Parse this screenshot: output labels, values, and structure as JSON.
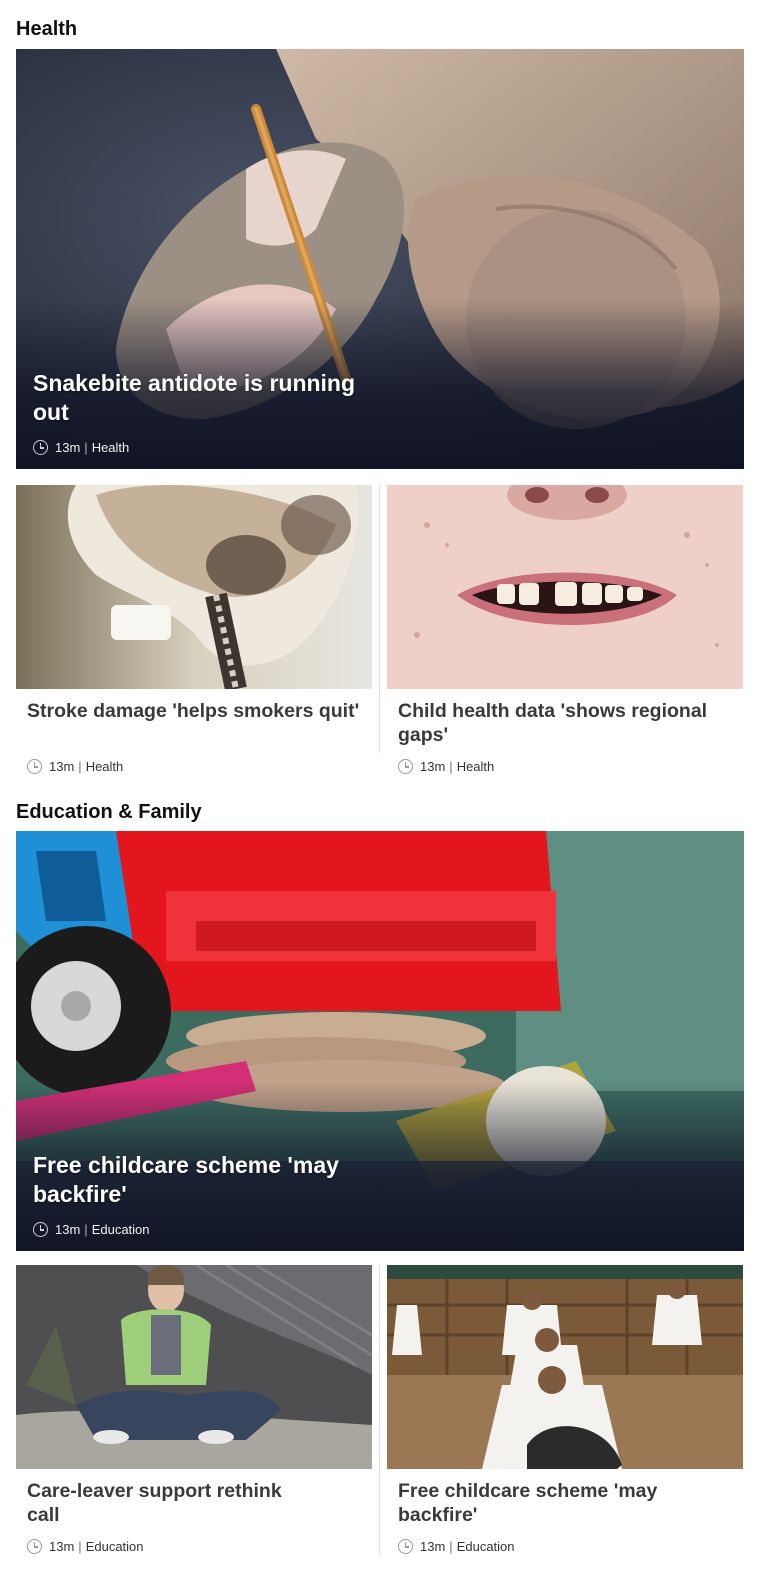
{
  "health": {
    "title": "Health",
    "hero": {
      "headline": "Snakebite antidote is running out",
      "time": "13m",
      "category": "Health"
    },
    "cards": [
      {
        "headline": "Stroke damage 'helps smokers quit'",
        "time": "13m",
        "category": "Health"
      },
      {
        "headline": "Child health data 'shows regional gaps'",
        "time": "13m",
        "category": "Health"
      }
    ]
  },
  "education": {
    "title": "Education & Family",
    "hero": {
      "headline": "Free childcare scheme 'may backfire'",
      "time": "13m",
      "category": "Education"
    },
    "cards": [
      {
        "headline": "Care-leaver support rethink call",
        "time": "13m",
        "category": "Education"
      },
      {
        "headline": "Free childcare scheme 'may backfire'",
        "time": "13m",
        "category": "Education"
      }
    ]
  },
  "meta_separator": "|",
  "icons": {
    "clock": "clock-icon"
  }
}
